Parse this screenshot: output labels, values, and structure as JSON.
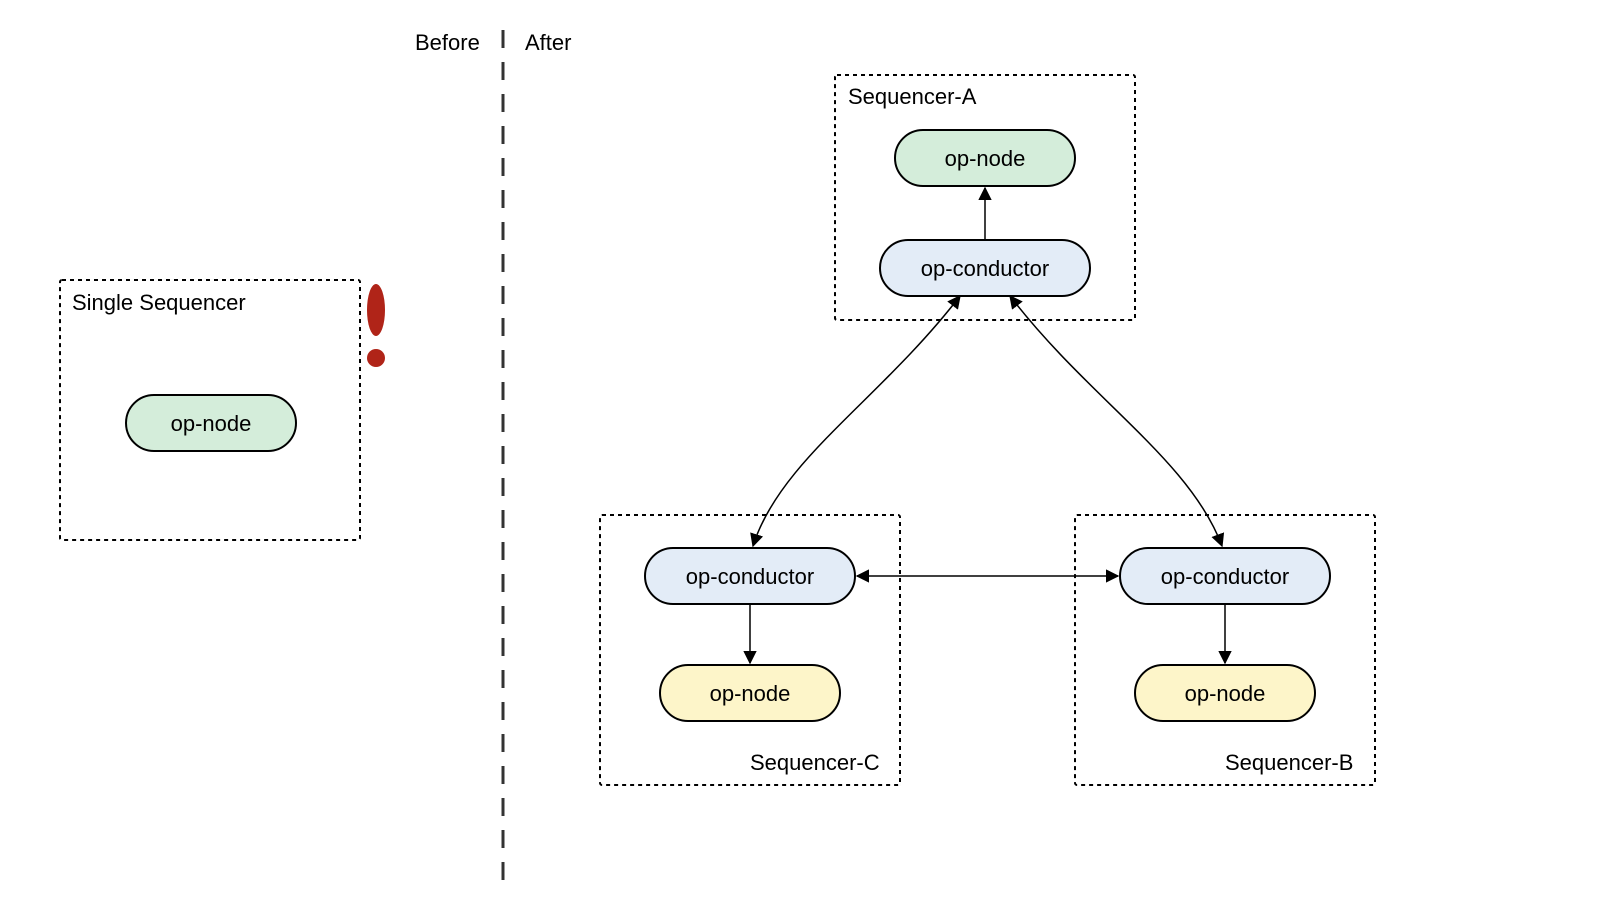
{
  "headings": {
    "before": "Before",
    "after": "After"
  },
  "before": {
    "box_label": "Single Sequencer",
    "node_label": "op-node"
  },
  "after": {
    "seqA": {
      "label": "Sequencer-A",
      "node": "op-node",
      "conductor": "op-conductor"
    },
    "seqB": {
      "label": "Sequencer-B",
      "node": "op-node",
      "conductor": "op-conductor"
    },
    "seqC": {
      "label": "Sequencer-C",
      "node": "op-node",
      "conductor": "op-conductor"
    }
  },
  "colors": {
    "green": "#d4edda",
    "blue": "#e3ecf7",
    "yellow": "#fdf5c9",
    "alert": "#b02418"
  }
}
